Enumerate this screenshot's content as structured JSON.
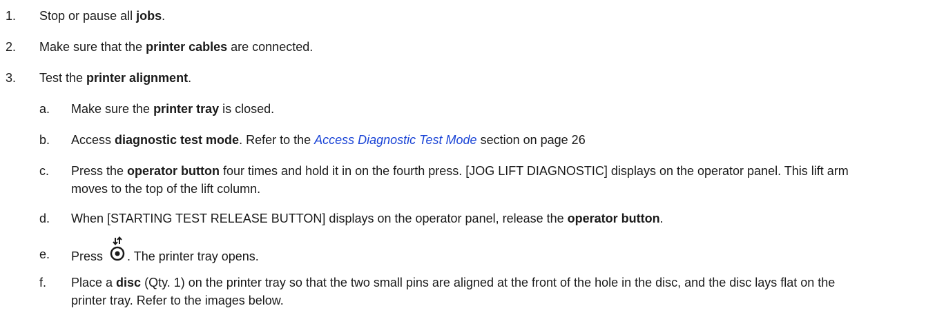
{
  "steps": [
    {
      "marker": "1.",
      "pre": "Stop or pause all ",
      "bold": "jobs",
      "post": "."
    },
    {
      "marker": "2.",
      "pre": "Make sure that the ",
      "bold": "printer cables",
      "post": " are connected."
    },
    {
      "marker": "3.",
      "pre": "Test the ",
      "bold": "printer alignment",
      "post": "."
    }
  ],
  "substeps": {
    "a": {
      "marker": "a.",
      "pre": "Make sure the ",
      "bold": "printer tray",
      "post": " is closed."
    },
    "b": {
      "marker": "b.",
      "pre": "Access ",
      "bold": "diagnostic test mode",
      "mid": ". Refer to the ",
      "link": "Access Diagnostic Test Mode",
      "post": " section on page 26"
    },
    "c": {
      "marker": "c.",
      "pre": "Press the ",
      "bold": "operator button",
      "post": " four times and hold it in on the fourth press. [JOG LIFT DIAGNOSTIC] displays on the operator panel. This lift arm moves to the top of the lift column."
    },
    "d": {
      "marker": "d.",
      "pre": "When [STARTING TEST RELEASE BUTTON] displays on the operator panel, release the ",
      "bold": "operator button",
      "post": "."
    },
    "e": {
      "marker": "e.",
      "pre": "Press",
      "icon": "printer-tray-eject-icon",
      "post": ". The printer tray opens."
    },
    "f": {
      "marker": "f.",
      "pre": "Place a ",
      "bold": "disc",
      "post": " (Qty. 1) on the printer tray so that the two small pins are aligned at the front of the hole in the disc, and the disc lays flat on the printer tray. Refer to the images below."
    }
  }
}
